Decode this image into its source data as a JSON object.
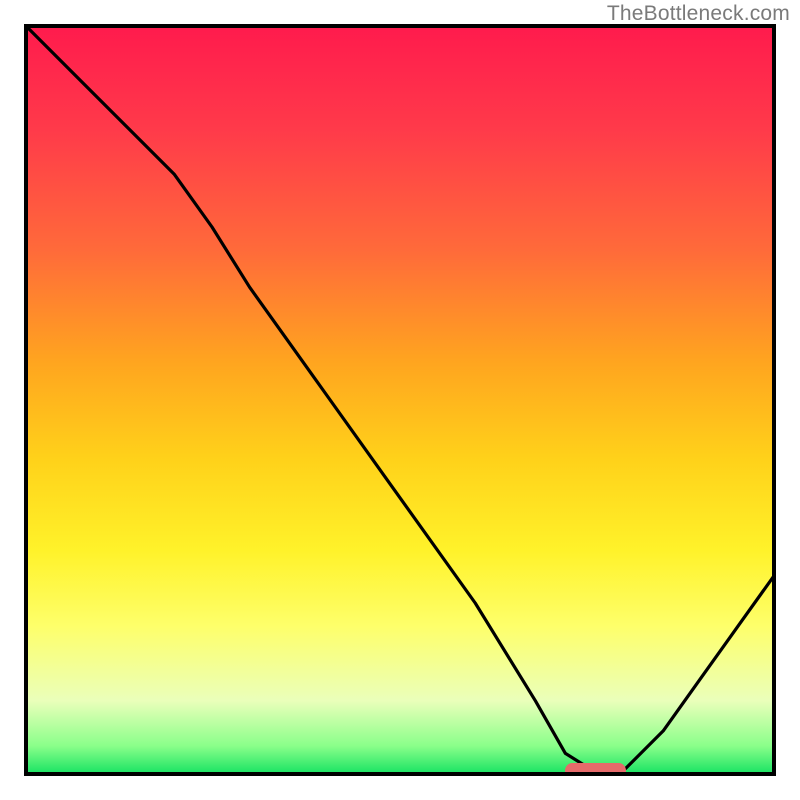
{
  "watermark": "TheBottleneck.com",
  "colors": {
    "gradient_top": "#ff1a4d",
    "gradient_bottom": "#10e060",
    "curve": "#000000",
    "border": "#000000",
    "marker": "#e66a6a",
    "watermark_text": "#7a7a7a"
  },
  "chart_data": {
    "type": "line",
    "title": "",
    "xlabel": "",
    "ylabel": "",
    "xlim": [
      0,
      100
    ],
    "ylim": [
      0,
      100
    ],
    "grid": false,
    "legend": false,
    "background": "rainbow-gradient",
    "series": [
      {
        "name": "bottleneck-curve",
        "x": [
          0,
          8,
          20,
          25,
          30,
          40,
          50,
          60,
          68,
          72,
          76,
          80,
          85,
          90,
          95,
          100
        ],
        "y": [
          100,
          92,
          80,
          73,
          65,
          51,
          37,
          23,
          10,
          3,
          0.5,
          1,
          6,
          13,
          20,
          27
        ]
      }
    ],
    "annotations": [
      {
        "name": "minimum-marker",
        "shape": "rounded-bar",
        "x_start": 72,
        "x_end": 80,
        "y": 0.8,
        "color": "#e66a6a"
      }
    ]
  }
}
